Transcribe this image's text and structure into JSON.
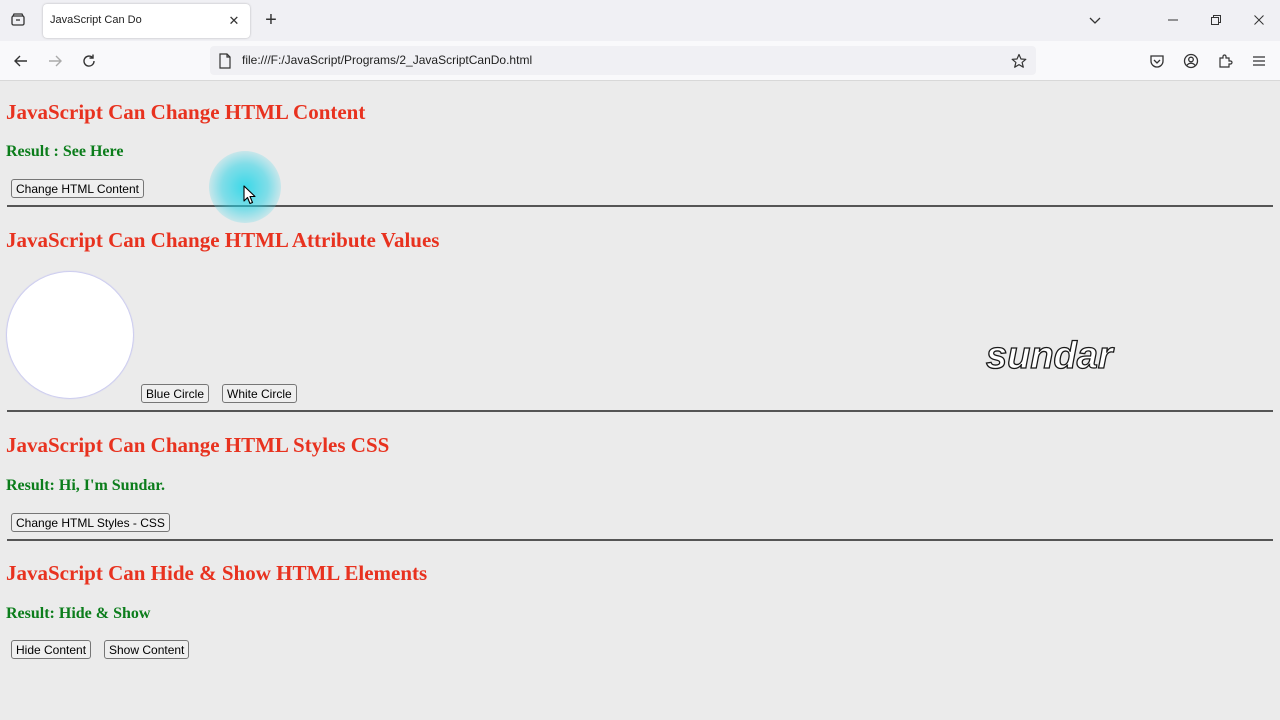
{
  "browser": {
    "tab_title": "JavaScript Can Do",
    "tab_close": "✕",
    "new_tab": "+",
    "url": "file:///F:/JavaScript/Programs/2_JavaScriptCanDo.html"
  },
  "page": {
    "section1": {
      "heading": "JavaScript Can Change HTML Content",
      "result": "Result : See Here",
      "button": "Change HTML Content"
    },
    "section2": {
      "heading": "JavaScript Can Change HTML Attribute Values",
      "blue_button": "Blue Circle",
      "white_button": "White Circle",
      "circle_color": "#ffffff",
      "sundar_text": "sundar"
    },
    "section3": {
      "heading": "JavaScript Can Change HTML Styles CSS",
      "result": "Result: Hi, I'm Sundar.",
      "button": "Change HTML Styles - CSS"
    },
    "section4": {
      "heading": "JavaScript Can Hide & Show HTML Elements",
      "result": "Result: Hide & Show",
      "hide_button": "Hide Content",
      "show_button": "Show Content"
    }
  },
  "colors": {
    "heading": "#e8321f",
    "result": "#0b7d1b",
    "cursor_halo": "#00d2e6"
  }
}
